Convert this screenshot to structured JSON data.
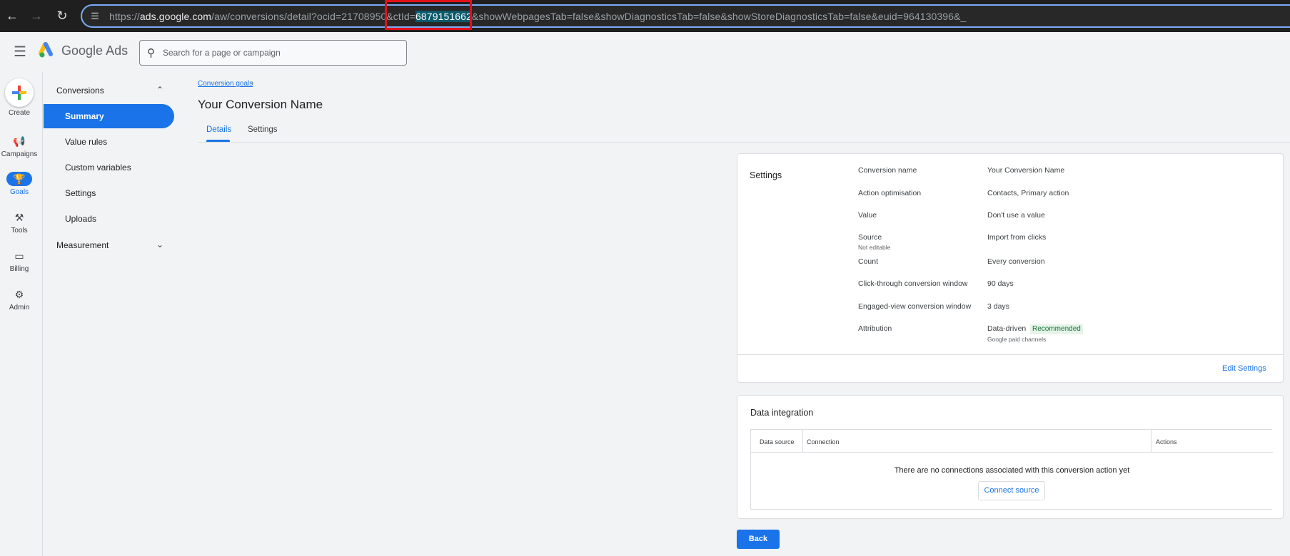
{
  "browser": {
    "url_prefix": "https://",
    "url_host": "ads.google.com",
    "url_path_before": "/aw/conversions/detail?ocid=21708950&ctId=",
    "url_highlight": "6879151662",
    "url_path_after": "&showWebpagesTab=false&showDiagnosticsTab=false&showStoreDiagnosticsTab=false&euid=964130396&_",
    "highlight_color": "#e3101a"
  },
  "header": {
    "brand_google": "Google",
    "brand_ads": "Ads",
    "search_placeholder": "Search for a page or campaign"
  },
  "rail": {
    "create": "Create",
    "items": [
      {
        "label": "Campaigns",
        "icon": "megaphone-icon"
      },
      {
        "label": "Goals",
        "icon": "trophy-icon",
        "active": true
      },
      {
        "label": "Tools",
        "icon": "tools-icon"
      },
      {
        "label": "Billing",
        "icon": "card-icon"
      },
      {
        "label": "Admin",
        "icon": "gear-icon"
      }
    ]
  },
  "subnav": {
    "section_conversions": "Conversions",
    "items": [
      "Summary",
      "Value rules",
      "Custom variables",
      "Settings",
      "Uploads"
    ],
    "active_index": 0,
    "section_measurement": "Measurement"
  },
  "main": {
    "breadcrumb": "Conversion goals",
    "title": "Your Conversion Name",
    "tabs": [
      "Details",
      "Settings"
    ],
    "active_tab": "Details"
  },
  "settings_card": {
    "title": "Settings",
    "rows": [
      {
        "label": "Conversion name",
        "value": "Your Conversion Name"
      },
      {
        "label": "Action optimisation",
        "value": "Contacts, Primary action"
      },
      {
        "label": "Value",
        "value": "Don't use a value"
      },
      {
        "label": "Source",
        "sublabel": "Not editable",
        "value": "Import from clicks"
      },
      {
        "label": "Count",
        "value": "Every conversion"
      },
      {
        "label": "Click-through conversion window",
        "value": "90 days"
      },
      {
        "label": "Engaged-view conversion window",
        "value": "3 days"
      },
      {
        "label": "Attribution",
        "value": "Data-driven",
        "badge": "Recommended",
        "subvalue": "Google paid channels"
      }
    ],
    "edit_label": "Edit Settings"
  },
  "data_card": {
    "title": "Data integration",
    "columns": [
      "Data source",
      "Connection",
      "Actions"
    ],
    "empty_message": "There are no connections associated with this conversion action yet",
    "connect_label": "Connect source"
  },
  "footer": {
    "back_label": "Back"
  }
}
